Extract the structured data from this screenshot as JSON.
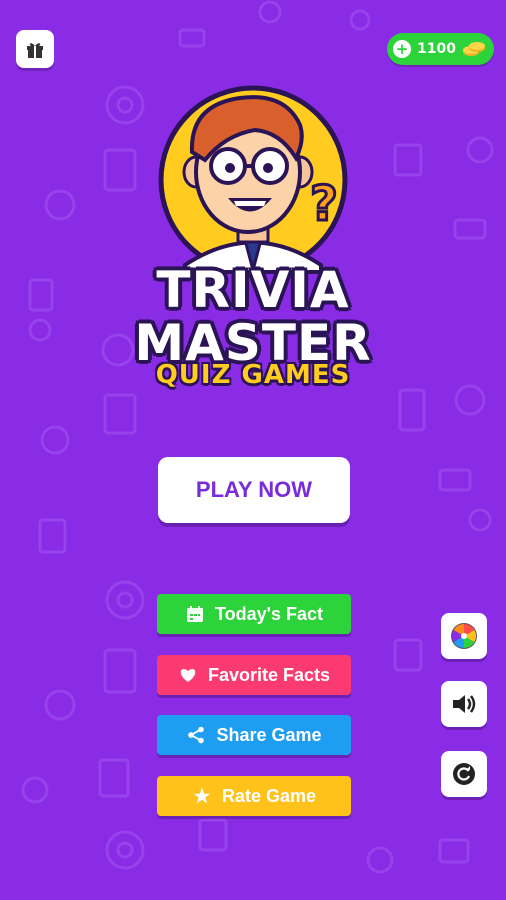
{
  "header": {
    "gift_icon": "gift-icon",
    "coins": {
      "value": "1100",
      "plus_icon": "plus-icon",
      "coin_icon": "coins-icon"
    }
  },
  "logo": {
    "title_line1": "TRIVIA",
    "title_line2": "MASTER",
    "subtitle": "QUIZ GAMES",
    "mascot": "smiling-boy-with-glasses-and-question-mark",
    "question_mark": "?"
  },
  "play_button": {
    "label": "PLAY NOW"
  },
  "menu": [
    {
      "label": "Today's Fact",
      "icon": "calendar-icon",
      "color": "#2dd33a"
    },
    {
      "label": "Favorite Facts",
      "icon": "heart-icon",
      "color": "#fb3a71"
    },
    {
      "label": "Share Game",
      "icon": "share-icon",
      "color": "#1e9ef3"
    },
    {
      "label": "Rate Game",
      "icon": "star-icon",
      "color": "#ffc21a"
    }
  ],
  "side_buttons": [
    {
      "icon": "spin-wheel-icon"
    },
    {
      "icon": "speaker-icon"
    },
    {
      "icon": "refresh-icon"
    }
  ],
  "colors": {
    "background": "#8a2be6",
    "play_text": "#7b2bd8",
    "title_outline": "#2a1456",
    "subtitle": "#ffcc1f"
  }
}
